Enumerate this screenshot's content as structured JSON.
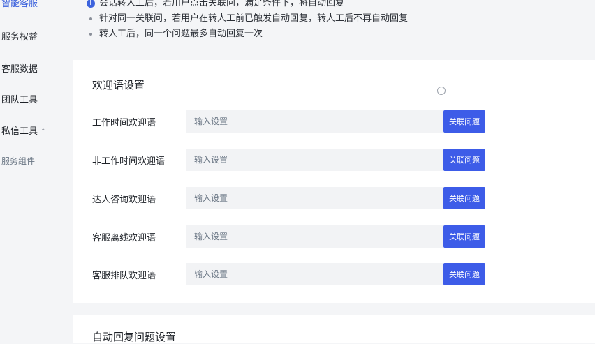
{
  "sidebar": {
    "items": [
      {
        "label": "智能客服",
        "state": "active"
      },
      {
        "label": "服务权益"
      },
      {
        "label": "客服数据"
      },
      {
        "label": "团队工具"
      },
      {
        "label": "私信工具",
        "expanded": true
      },
      {
        "label": "服务组件",
        "sub": true
      }
    ]
  },
  "notes": [
    "会话转人工后，若用户点击关联问，满足条件下，将自动回复",
    "针对同一关联问，若用户在转人工前已触发自动回复，转人工后不再自动回复",
    "转人工后，同一个问题最多自动回复一次"
  ],
  "welcome": {
    "title": "欢迎语设置",
    "rows": [
      {
        "label": "工作时间欢迎语",
        "placeholder": "输入设置",
        "button": "关联问题"
      },
      {
        "label": "非工作时间欢迎语",
        "placeholder": "输入设置",
        "button": "关联问题"
      },
      {
        "label": "达人咨询欢迎语",
        "placeholder": "输入设置",
        "button": "关联问题"
      },
      {
        "label": "客服离线欢迎语",
        "placeholder": "输入设置",
        "button": "关联问题"
      },
      {
        "label": "客服排队欢迎语",
        "placeholder": "输入设置",
        "button": "关联问题"
      }
    ]
  },
  "auto_reply": {
    "title": "自动回复问题设置"
  },
  "colors": {
    "accent": "#3d5ce8",
    "background": "#f4f5f7",
    "panel": "#ffffff",
    "input_bg": "#f2f3f5"
  },
  "icons": {
    "info": "info-icon",
    "chevron": "chevron-up-icon",
    "cursor": "cursor-icon"
  }
}
